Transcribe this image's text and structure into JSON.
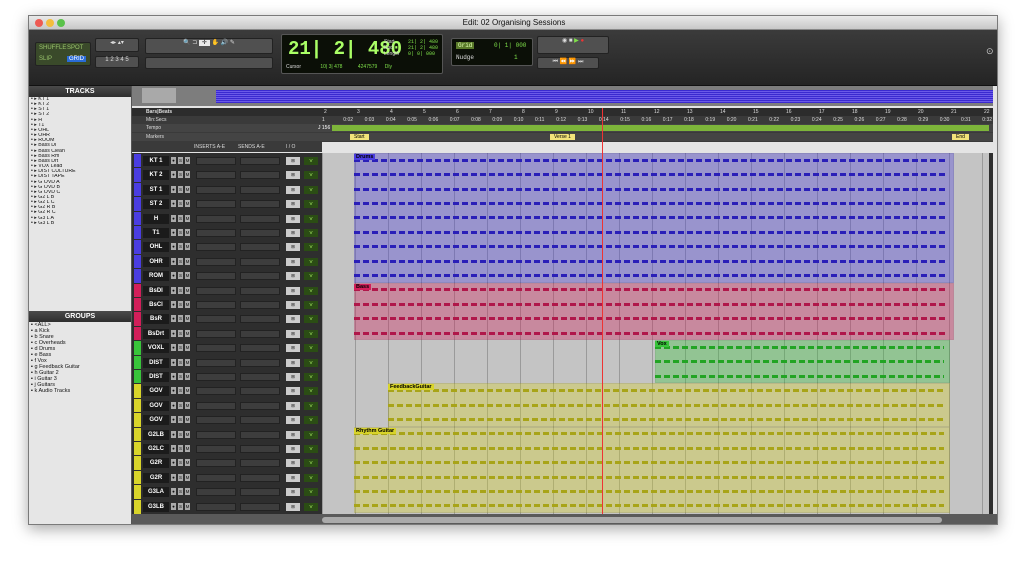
{
  "window": {
    "title": "Edit: 02 Organising Sessions"
  },
  "toolbar": {
    "modes": [
      "SHUFFLE",
      "SPOT",
      "SLIP",
      "GRID"
    ],
    "zoom_presets": [
      "1",
      "2",
      "3",
      "4",
      "5"
    ],
    "main_counter": "21| 2| 480",
    "start_label": "Start",
    "start": "21| 2| 480",
    "end_label": "End",
    "end": "21| 2| 480",
    "length_label": "Length",
    "length": "0| 0| 000",
    "cursor_label": "Cursor",
    "cursor": "10| 3| 478",
    "sample": "4247579",
    "dly_label": "Dly",
    "grid_label": "Grid",
    "grid_value": "0| 1| 000",
    "nudge_label": "Nudge",
    "nudge_value": "1"
  },
  "tracks_panel": {
    "title": "TRACKS",
    "items": [
      "KT 1",
      "KT 2",
      "ST 1",
      "ST 2",
      "H",
      "T1",
      "OHL",
      "OHR",
      "ROOM",
      "Bass DI",
      "Bass Clean",
      "Bass Rm",
      "Bass Drt",
      "VOX Lead",
      "DIST CULTURE",
      "DIST TAPE",
      "G OVD A",
      "G OVD B",
      "G OVD C",
      "G2 L B",
      "G2 L C",
      "G2 R B",
      "G2 R C",
      "G3 L A",
      "G3 L B"
    ]
  },
  "groups_panel": {
    "title": "GROUPS",
    "items": [
      {
        "letter": "",
        "name": "<ALL>"
      },
      {
        "letter": "a",
        "name": "Kick"
      },
      {
        "letter": "b",
        "name": "Snare"
      },
      {
        "letter": "c",
        "name": "Overheads"
      },
      {
        "letter": "d",
        "name": "Drums"
      },
      {
        "letter": "e",
        "name": "Bass"
      },
      {
        "letter": "f",
        "name": "Vox"
      },
      {
        "letter": "g",
        "name": "Feedback Guitar"
      },
      {
        "letter": "h",
        "name": "Guitar 2"
      },
      {
        "letter": "i",
        "name": "Guitar 3"
      },
      {
        "letter": "j",
        "name": "Guitars"
      },
      {
        "letter": "k",
        "name": "Audio Tracks"
      }
    ]
  },
  "rulers": {
    "bars_beats": "Bars|Beats",
    "min_secs": "Min:Secs",
    "tempo": "Tempo",
    "tempo_value": "J 156",
    "markers": "Markers",
    "bars": [
      "2",
      "3",
      "4",
      "5",
      "6",
      "7",
      "8",
      "9",
      "10",
      "11",
      "12",
      "13",
      "14",
      "15",
      "16",
      "17",
      "18",
      "19",
      "20",
      "21",
      "22"
    ],
    "secs": [
      "1",
      "0:02",
      "0:03",
      "0:04",
      "0:05",
      "0:06",
      "0:07",
      "0:08",
      "0:09",
      "0:10",
      "0:11",
      "0:12",
      "0:13",
      "0:14",
      "0:15",
      "0:16",
      "0:17",
      "0:18",
      "0:19",
      "0:20",
      "0:21",
      "0:22",
      "0:23",
      "0:24",
      "0:25",
      "0:26",
      "0:27",
      "0:28",
      "0:29",
      "0:30",
      "0:31",
      "0:32"
    ],
    "marker_list": [
      "Start",
      "Verse 1",
      "End"
    ]
  },
  "mix_header": {
    "inserts": "INSERTS A-E",
    "sends": "SENDS A-E",
    "io": "I / O"
  },
  "tracks": [
    {
      "name": "KT 1",
      "color": "#4a3de0"
    },
    {
      "name": "KT 2",
      "color": "#4a3de0"
    },
    {
      "name": "ST 1",
      "color": "#4a3de0"
    },
    {
      "name": "ST 2",
      "color": "#4a3de0"
    },
    {
      "name": "H",
      "color": "#4a3de0"
    },
    {
      "name": "T1",
      "color": "#4a3de0"
    },
    {
      "name": "OHL",
      "color": "#4a3de0"
    },
    {
      "name": "OHR",
      "color": "#4a3de0"
    },
    {
      "name": "ROM",
      "color": "#4a3de0"
    },
    {
      "name": "BsDI",
      "color": "#d21f5a"
    },
    {
      "name": "BsCl",
      "color": "#d21f5a"
    },
    {
      "name": "BsR",
      "color": "#d21f5a"
    },
    {
      "name": "BsDrt",
      "color": "#d21f5a"
    },
    {
      "name": "VOXL",
      "color": "#38c43a"
    },
    {
      "name": "DIST",
      "color": "#38c43a"
    },
    {
      "name": "DIST",
      "color": "#38c43a"
    },
    {
      "name": "GOV",
      "color": "#d8d42a"
    },
    {
      "name": "GOV",
      "color": "#d8d42a"
    },
    {
      "name": "GOV",
      "color": "#d8d42a"
    },
    {
      "name": "G2LB",
      "color": "#d8d42a"
    },
    {
      "name": "G2LC",
      "color": "#d8d42a"
    },
    {
      "name": "G2R",
      "color": "#d8d42a"
    },
    {
      "name": "G2R",
      "color": "#d8d42a"
    },
    {
      "name": "G3LA",
      "color": "#d8d42a"
    },
    {
      "name": "G3LB",
      "color": "#d8d42a"
    }
  ],
  "track_buttons": {
    "input": "I",
    "solo": "S",
    "mute": "M",
    "io": "no input",
    "voice_label": "V"
  },
  "clips": [
    {
      "name": "Drums"
    },
    {
      "name": "Bass"
    },
    {
      "name": "Vox"
    },
    {
      "name": "FeedbackGuitar"
    },
    {
      "name": "Rhythm Guitar"
    }
  ],
  "colors": {
    "drums": "#4a3de0",
    "bass": "#d21f5a",
    "vox": "#38c43a",
    "guitar": "#d8d42a"
  }
}
